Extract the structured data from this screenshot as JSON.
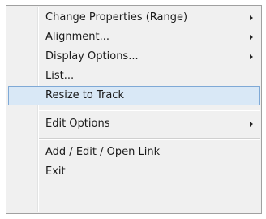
{
  "menu": {
    "items": [
      {
        "label": "Change Properties (Range)",
        "submenu": true
      },
      {
        "label": "Alignment...",
        "submenu": true
      },
      {
        "label": "Display Options...",
        "submenu": true
      },
      {
        "label": "List...",
        "submenu": false
      },
      {
        "label": "Resize to Track",
        "submenu": false,
        "highlighted": true
      },
      {
        "label": "Edit Options",
        "submenu": true
      },
      {
        "label": "Add / Edit / Open Link",
        "submenu": false
      },
      {
        "label": "Exit",
        "submenu": false
      }
    ],
    "highlight_color": "#d9e8f6",
    "highlight_border_color": "#7fa9d6",
    "background_color": "#f0f0f0"
  }
}
